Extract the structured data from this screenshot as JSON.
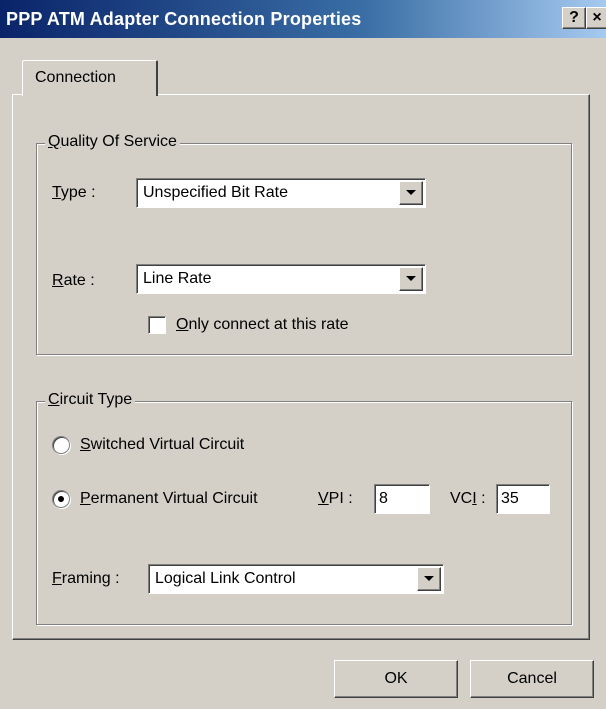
{
  "window": {
    "title": "PPP ATM Adapter Connection Properties",
    "help_glyph": "?",
    "close_glyph": "×"
  },
  "tabs": [
    {
      "label": "Connection",
      "selected": true
    }
  ],
  "qos": {
    "group_label_accel": "Q",
    "group_label_rest": "uality Of Service",
    "type": {
      "label_accel": "T",
      "label_rest": "ype :",
      "value": "Unspecified Bit Rate"
    },
    "rate": {
      "label_accel": "R",
      "label_rest": "ate :",
      "value": "Line Rate"
    },
    "only_connect": {
      "label_accel": "O",
      "label_rest": "nly connect at this rate",
      "checked": false
    }
  },
  "circuit": {
    "group_label_accel": "C",
    "group_label_rest": "ircuit Type",
    "svc": {
      "label_accel": "S",
      "label_rest": "witched Virtual Circuit",
      "selected": false
    },
    "pvc": {
      "label_accel": "P",
      "label_rest": "ermanent Virtual Circuit",
      "selected": true
    },
    "vpi": {
      "label_accel": "V",
      "label_rest": "PI :",
      "value": "8"
    },
    "vci": {
      "label_pre": "VC",
      "label_accel": "I",
      "label_post": " :",
      "value": "35"
    },
    "framing": {
      "label_accel": "F",
      "label_rest": "raming :",
      "value": "Logical Link Control"
    }
  },
  "buttons": {
    "ok": "OK",
    "cancel": "Cancel"
  },
  "colors": {
    "face": "#d4d0c8",
    "title_start": "#0a246a",
    "title_end": "#a6caf0"
  }
}
